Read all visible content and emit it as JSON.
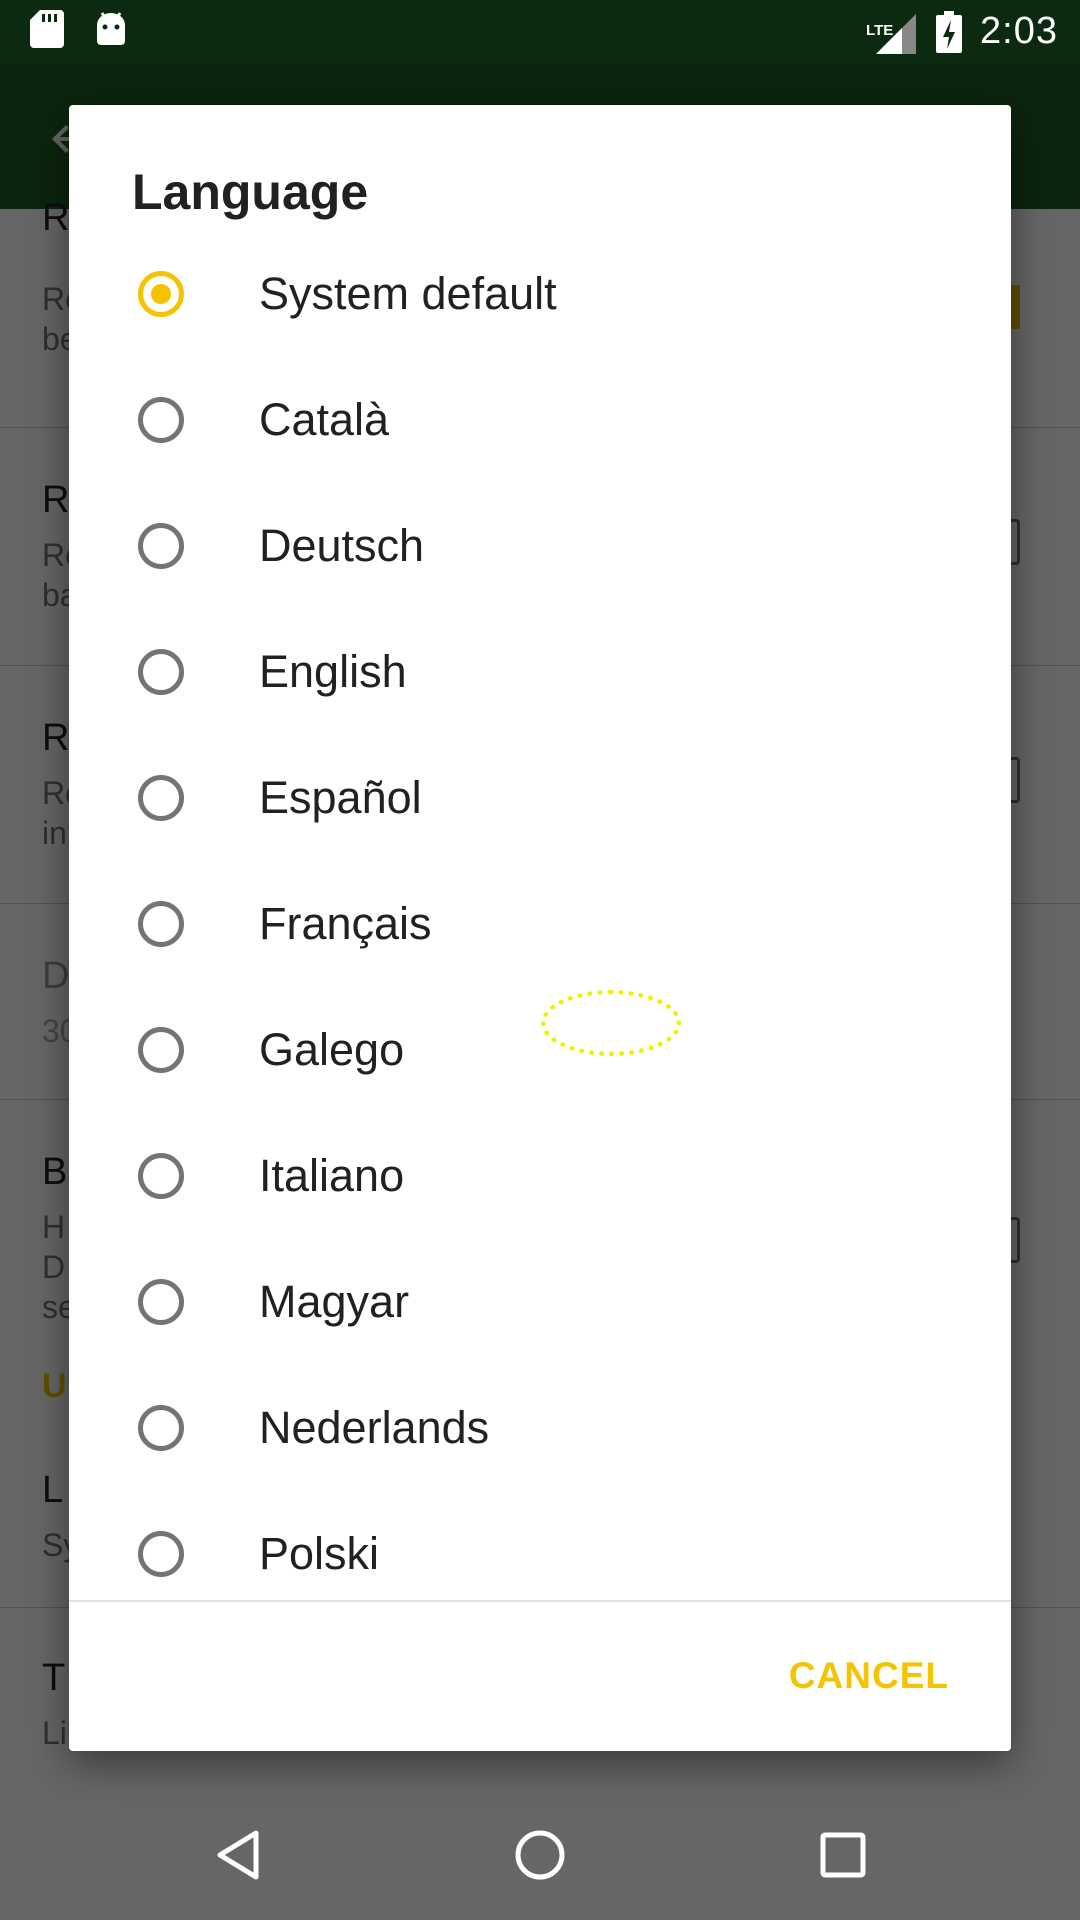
{
  "status_bar": {
    "time": "2:03",
    "network": "LTE",
    "icons": [
      "sd-card-icon",
      "android-icon",
      "signal-icon",
      "battery-charging-icon"
    ]
  },
  "background": {
    "rows": [
      {
        "title": "R",
        "sub": "Re\nbe"
      },
      {
        "title": "R",
        "sub": "Re\nba"
      },
      {
        "title": "R",
        "sub": "Re\nin"
      },
      {
        "title": "D",
        "sub": "30"
      },
      {
        "title": "B",
        "sub": "H\nD\nse"
      },
      {
        "title": "L",
        "sub": "Sy"
      },
      {
        "title": "T",
        "sub": "Li"
      }
    ],
    "section_header": "U"
  },
  "dialog": {
    "title": "Language",
    "selected": "System default",
    "options": [
      "System default",
      "Català",
      "Deutsch",
      "English",
      "Español",
      "Français",
      "Galego",
      "Italiano",
      "Magyar",
      "Nederlands",
      "Polski"
    ],
    "cancel_label": "CANCEL"
  },
  "colors": {
    "accent": "#f5c400",
    "app_bar": "#1f5e23",
    "status_bar": "#0c2a10"
  },
  "nav_bar": {
    "icons": [
      "back-icon",
      "home-icon",
      "recents-icon"
    ]
  }
}
